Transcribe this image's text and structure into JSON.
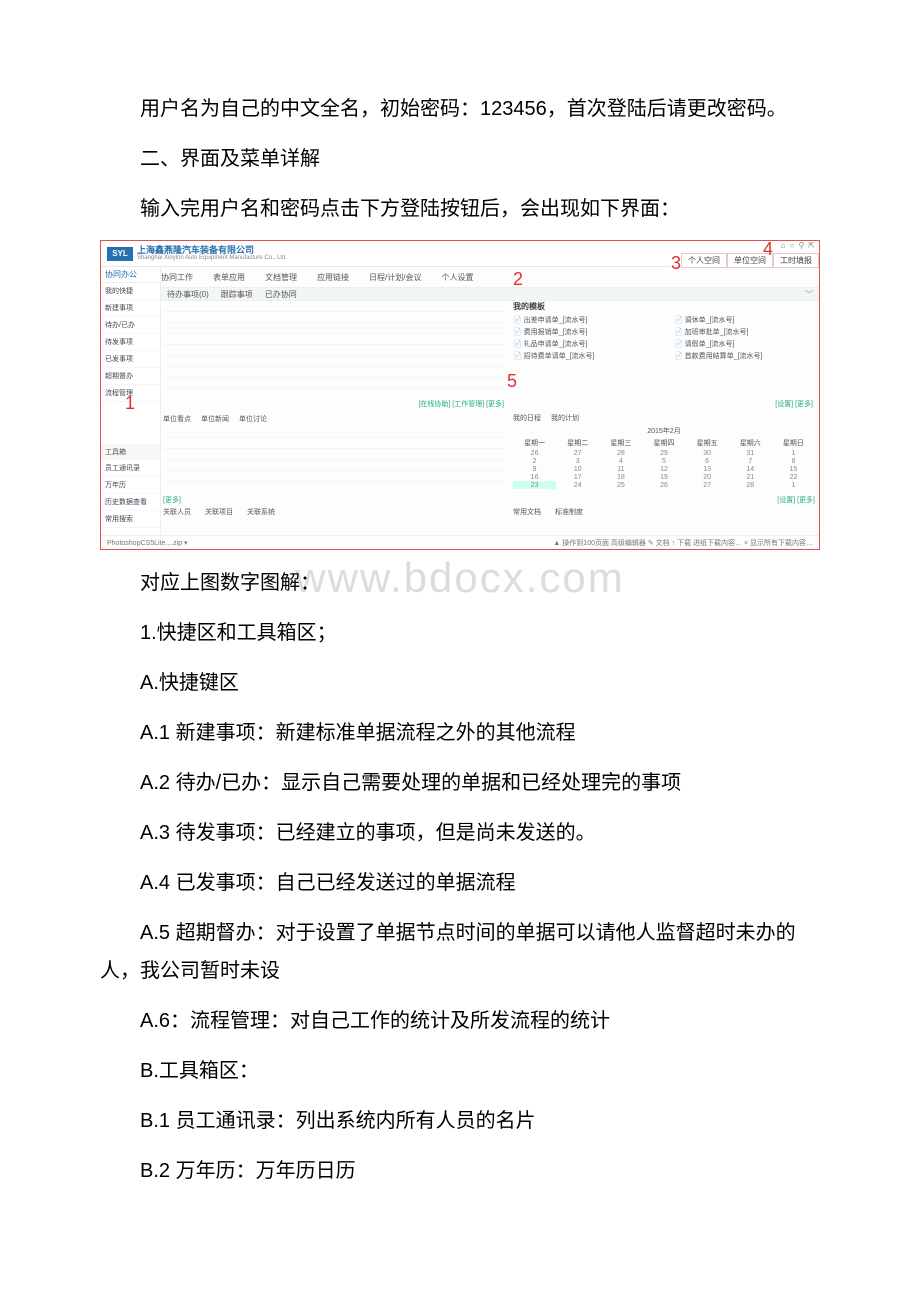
{
  "paragraphs": {
    "p1": "用户名为自己的中文全名，初始密码：123456，首次登陆后请更改密码。",
    "p2": "二、界面及菜单详解",
    "p3": "输入完用户名和密码点击下方登陆按钮后，会出现如下界面：",
    "p4": "对应上图数字图解：",
    "p5": "1.快捷区和工具箱区；",
    "p6": "A.快捷键区",
    "p7": "A.1 新建事项：新建标准单据流程之外的其他流程",
    "p8": "A.2 待办/已办：显示自己需要处理的单据和已经处理完的事项",
    "p9": "A.3 待发事项：已经建立的事项，但是尚未发送的。",
    "p10": "A.4 已发事项：自己已经发送过的单据流程",
    "p11": "A.5 超期督办：对于设置了单据节点时间的单据可以请他人监督超时未办的人，我公司暂时未设",
    "p12": "A.6：流程管理：对自己工作的统计及所发流程的统计",
    "p13": "B.工具箱区：",
    "p14": "B.1 员工通讯录：列出系统内所有人员的名片",
    "p15": "B.2 万年历：万年历日历"
  },
  "watermark": "www.bdocx.com",
  "screenshot": {
    "logo": "SYL",
    "company_cn": "上海鑫燕隆汽车装备有限公司",
    "company_en": "Shanghai Xinylon Auto Equipment Manufacture Co., Ltd.",
    "top_icons": [
      "⌂",
      "○",
      "⚲",
      "⇱"
    ],
    "space_tabs": [
      "个人空间",
      "单位空间",
      "工时填报"
    ],
    "side_top": "协同办公",
    "side_shortcut_label": "我的快捷",
    "sidebar_items": [
      "新建事项",
      "待办/已办",
      "待发事项",
      "已发事项",
      "超期督办",
      "流程管理"
    ],
    "toolbox_label": "工具箱",
    "toolbox_items": [
      "员工通讯录",
      "万年历",
      "历史数据查看",
      "常用搜索"
    ],
    "main_nav": [
      "协同工作",
      "表单应用",
      "文档管理",
      "应用链接",
      "日程/计划/会议",
      "个人设置"
    ],
    "tabs": [
      "待办事项(0)",
      "跟踪事项",
      "已办协同"
    ],
    "mini_right": "﹀",
    "right_title": "我的模板",
    "templates_col1": [
      "出差申请单_[流水号]",
      "费用报销单_[流水号]",
      "礼品申请单_[流水号]",
      "招待费单请单_[流水号]"
    ],
    "templates_col2": [
      "调休单_[流水号]",
      "加班审批单_[流水号]",
      "请假单_[流水号]",
      "首款费用结算单_[流水号]"
    ],
    "midlinks": "[在线协助] [工作管理] [更多]",
    "midlinks2": "[设置] [更多]",
    "unit_tabs": [
      "单位看点",
      "单位新闻",
      "单位讨论"
    ],
    "cal_tabs": [
      "我的日程",
      "我的计划"
    ],
    "cal_month": "2015年2月",
    "cal_head": [
      "星期一",
      "星期二",
      "星期三",
      "星期四",
      "星期五",
      "星期六",
      "星期日"
    ],
    "cal_days": [
      "26",
      "27",
      "28",
      "29",
      "30",
      "31",
      "1",
      "2",
      "3",
      "4",
      "5",
      "6",
      "7",
      "8",
      "9",
      "10",
      "11",
      "12",
      "13",
      "14",
      "15",
      "16",
      "17",
      "18",
      "19",
      "20",
      "21",
      "22",
      "23",
      "24",
      "25",
      "26",
      "27",
      "28",
      "1"
    ],
    "cal_today_index": 28,
    "linkrow_left": "[更多]",
    "linkrow_right": "[设置] [更多]",
    "related_tabs": [
      "关联人员",
      "关联项目",
      "关联系统"
    ],
    "docs_tabs": [
      "常用文档",
      "标准制度"
    ],
    "footer_left": "PhotoshopCS5Lite....zip  ▾",
    "footer_right": "▲ 操作到100页面    高级编辑器  ✎ 文档  ↑ 下载  进纸下载内容…  ×  显示所有下载内容…",
    "annotations": {
      "a1": "1",
      "a2": "2",
      "a3": "3",
      "a4": "4",
      "a5": "5"
    }
  }
}
